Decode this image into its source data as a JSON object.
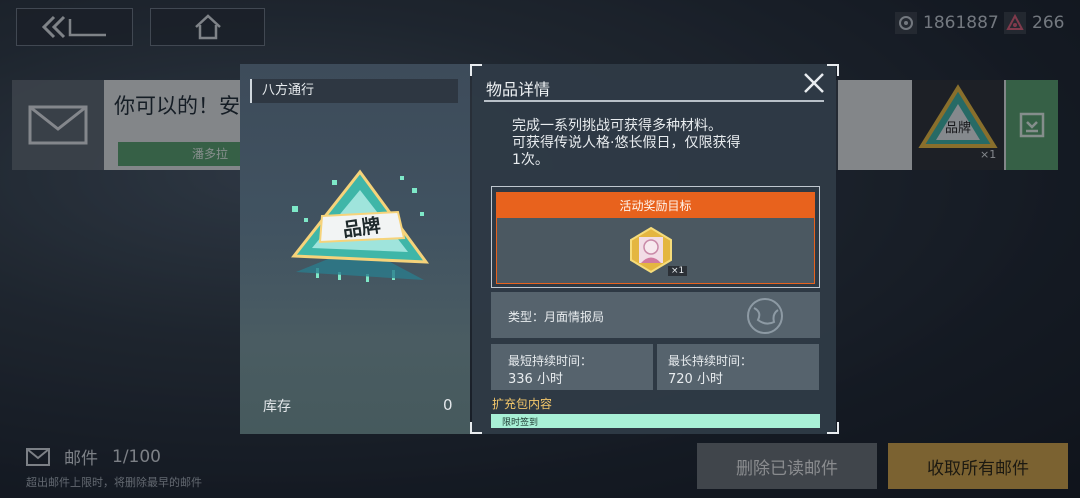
{
  "resources": {
    "currency_a": "1861887",
    "currency_b": "266"
  },
  "mail_preview": {
    "title": "你可以的！安",
    "sender": "潘多拉",
    "item_count": "×1"
  },
  "mail_footer": {
    "label": "邮件",
    "count": "1/100",
    "notice": "超出邮件上限时，将删除最早的邮件"
  },
  "buttons": {
    "delete_read": "删除已读邮件",
    "collect_all": "收取所有邮件"
  },
  "item_panel": {
    "name": "八方通行",
    "emblem_text": "品牌",
    "stock_label": "库存",
    "stock_value": "0"
  },
  "detail": {
    "title": "物品详情",
    "description_lines": [
      "完成一系列挑战可获得多种材料。",
      "可获得传说人格·悠长假日，仅限获得",
      "1次。"
    ],
    "reward_header": "活动奖励目标",
    "reward_count": "×1",
    "type_text": "类型：月面情报局",
    "min_duration_label": "最短持续时间：",
    "min_duration_value": "336 小时",
    "max_duration_label": "最长持续时间：",
    "max_duration_value": "720 小时",
    "pack_label": "扩充包内容",
    "pack_item": "限时签到"
  },
  "colors": {
    "accent_orange": "#e8621d",
    "accent_green": "#5aa56f",
    "accent_gold": "#d8a84a",
    "pack_bar": "#a8f0d6"
  }
}
